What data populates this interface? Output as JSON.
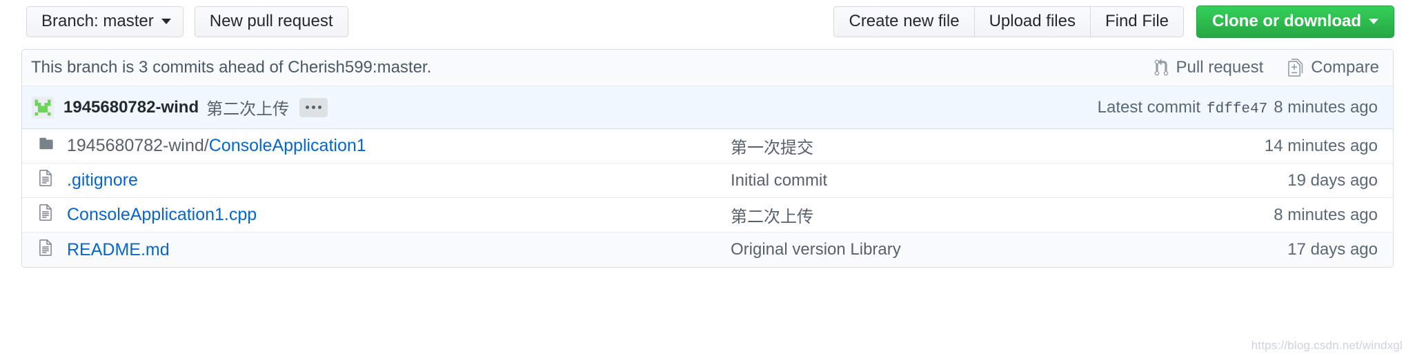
{
  "toolbar": {
    "branch_button": "Branch: master",
    "new_pull_request": "New pull request",
    "create_new_file": "Create new file",
    "upload_files": "Upload files",
    "find_file": "Find File",
    "clone_or_download": "Clone or download"
  },
  "branch_bar": {
    "status": "This branch is 3 commits ahead of Cherish599:master.",
    "pull_request": "Pull request",
    "compare": "Compare"
  },
  "latest_commit": {
    "author": "1945680782-wind",
    "message": "第二次上传",
    "ellipsis": "",
    "label": "Latest commit",
    "sha": "fdffe47",
    "time": "8 minutes ago"
  },
  "files": [
    {
      "icon": "folder-icon",
      "path_prefix": "1945680782-wind/",
      "name": "ConsoleApplication1",
      "message": "第一次提交",
      "time": "14 minutes ago"
    },
    {
      "icon": "file-icon",
      "path_prefix": "",
      "name": ".gitignore",
      "message": "Initial commit",
      "time": "19 days ago"
    },
    {
      "icon": "file-icon",
      "path_prefix": "",
      "name": "ConsoleApplication1.cpp",
      "message": "第二次上传",
      "time": "8 minutes ago"
    },
    {
      "icon": "file-icon",
      "path_prefix": "",
      "name": "README.md",
      "message": "Original version Library",
      "time": "17 days ago"
    }
  ],
  "watermark": "https://blog.csdn.net/windxgl",
  "colors": {
    "link": "#0366d6",
    "green_button": "#28a745",
    "commit_row_bg": "#f1f8ff",
    "muted": "#586069"
  }
}
